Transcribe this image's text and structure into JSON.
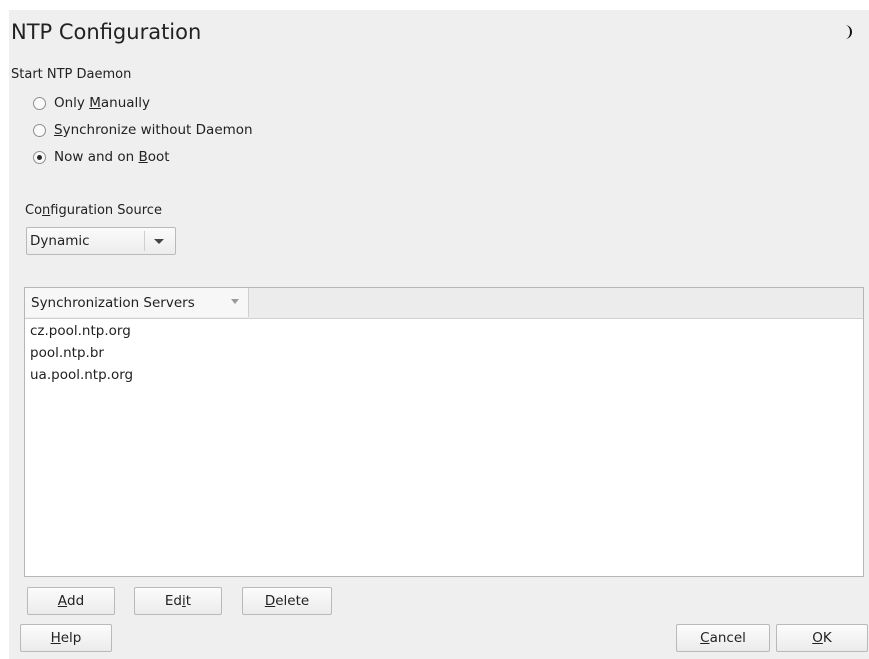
{
  "dialog": {
    "title": "NTP Configuration",
    "theme_icon": "moon-icon"
  },
  "daemon": {
    "label": "Start NTP Daemon",
    "options": [
      {
        "pre": "Only ",
        "mn": "M",
        "post": "anually",
        "selected": false
      },
      {
        "pre": "",
        "mn": "S",
        "post": "ynchronize without Daemon",
        "selected": false
      },
      {
        "pre": "Now and on ",
        "mn": "B",
        "post": "oot",
        "selected": true
      }
    ]
  },
  "config_source": {
    "label_pre": "Co",
    "label_mn": "n",
    "label_post": "figuration Source",
    "value": "Dynamic"
  },
  "servers": {
    "column": "Synchronization Servers",
    "rows": [
      "cz.pool.ntp.org",
      "pool.ntp.br",
      "ua.pool.ntp.org"
    ]
  },
  "table_buttons": {
    "add": {
      "pre": "",
      "mn": "A",
      "post": "dd"
    },
    "edit": {
      "pre": "Ed",
      "mn": "i",
      "post": "t"
    },
    "delete": {
      "pre": "",
      "mn": "D",
      "post": "elete"
    }
  },
  "footer": {
    "help": {
      "pre": "",
      "mn": "H",
      "post": "elp"
    },
    "cancel": {
      "pre": "",
      "mn": "C",
      "post": "ancel"
    },
    "ok": {
      "pre": "",
      "mn": "O",
      "post": "K"
    }
  },
  "colors": {
    "background": "#efefef",
    "table_bg": "#ffffff",
    "border": "#b9b9b9"
  }
}
